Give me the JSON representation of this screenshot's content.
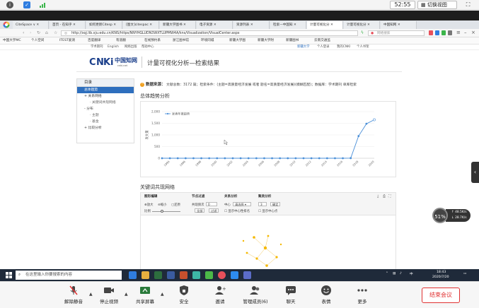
{
  "meeting_top": {
    "timer": "52:55",
    "switch_view": "切换视图"
  },
  "browser": {
    "tabs": [
      {
        "label": "CiteSpace ∨ ✕",
        "active": false
      },
      {
        "label": "首页 - 在知乎 ✕",
        "active": false
      },
      {
        "label": "如何更新Citesp ✕",
        "active": false
      },
      {
        "label": "[图文]citespac ✕",
        "active": false
      },
      {
        "label": "新疆大学图书 ✕",
        "active": false
      },
      {
        "label": "电子资源 ✕",
        "active": false
      },
      {
        "label": "资源列表 ✕",
        "active": false
      },
      {
        "label": "检索—中国知 ✕",
        "active": false
      },
      {
        "label": "计量可视化分 ✕",
        "active": true
      },
      {
        "label": "计量可视化分 ✕",
        "active": false
      },
      {
        "label": "中国知网 ✕",
        "active": false
      }
    ],
    "url": "http://xqj.lib.xju.edu.cn/KNS/https/NNYHGLUDN3WXTLUPMW4A/kns/Visualization/VisualCenter.aspx",
    "search_placeholder": "网络搜索",
    "bookmarks": [
      "中国大学MC",
      "个人空间",
      "ITEST爱测",
      "百度翻译",
      "有道翻",
      "在线预约系",
      "浙江图书馆",
      "环境同城",
      "新疆大学图",
      "新疆大学附",
      "新疆图书",
      "云南交通监"
    ],
    "site_nav": [
      "学术期刊",
      "English",
      "网络出版",
      "帮助中心"
    ],
    "site_nav_right": [
      "新疆大学",
      "个人登录",
      "我的CNKI",
      "个人书架"
    ]
  },
  "page": {
    "logo_text": "中国知网",
    "logo_sub": "cnki.net",
    "title": "计量可视化分析—检索结果",
    "left_nav": {
      "header": "目录",
      "items": [
        {
          "label": "总体趋势",
          "active": true,
          "level": 0
        },
        {
          "label": "+ 关系网络",
          "active": false,
          "level": 0
        },
        {
          "label": "· 关键词共现网络",
          "active": false,
          "level": 1
        },
        {
          "label": "- 分布",
          "active": false,
          "level": 0
        },
        {
          "label": "· 主题",
          "active": false,
          "level": 1
        },
        {
          "label": "· 基金",
          "active": false,
          "level": 1
        },
        {
          "label": "+ 比较分析",
          "active": false,
          "level": 0
        }
      ]
    },
    "crumb": {
      "source_label": "数据来源：",
      "text": "文献总数：3172 篇；检索条件：(主题=高质量经济发展 或者 题名=高质量经济发展)(模糊匹配)；数据库：学术期刊 单库检索"
    },
    "section1_title": "总体趋势分析",
    "section2_title": "关键词共现网络",
    "network_toolbar": {
      "g1_title": "图形编辑",
      "g1_items": [
        "放大",
        "缩小",
        "还原"
      ],
      "g1_zoom_label": "比例",
      "g2_title": "节点过滤",
      "g2_label": "共现频次",
      "g2_value": "0",
      "g2_btn1": "全部",
      "g2_btn2": "过滤",
      "g3_title": "关系分析",
      "g3_label": "中心",
      "g3_select": "请选择",
      "g3_chk": "显示中心性排名",
      "g4_title": "聚类分析",
      "g4_value": "3",
      "g4_btn": "确定",
      "g4_chk": "显示中心点"
    }
  },
  "chart_data": {
    "type": "line",
    "legend": [
      "发表年度趋势"
    ],
    "legend_position": "top-left",
    "ylabel": "发文量",
    "ylim": [
      0,
      2000
    ],
    "yticks": [
      0,
      500,
      1000,
      1500,
      2000
    ],
    "grid": true,
    "categories": [
      "1993",
      "1994",
      "1995",
      "1996",
      "1997",
      "1998",
      "1999",
      "2000",
      "2001",
      "2002",
      "2003",
      "2004",
      "2005",
      "2006",
      "2007",
      "2008",
      "2009",
      "2010",
      "2011",
      "2012",
      "2013",
      "2014",
      "2015",
      "2016",
      "2017",
      "2018",
      "2019",
      "2020"
    ],
    "xtick_labels": [
      "1994",
      "1996",
      "1998",
      "2000",
      "2002",
      "2004",
      "2006",
      "2008",
      "2010",
      "2012",
      "2014",
      "2016",
      "2018",
      "2020"
    ],
    "series": [
      {
        "name": "发表年度趋势",
        "color": "#4a8fd8",
        "values": [
          1,
          1,
          1,
          1,
          1,
          1,
          1,
          1,
          1,
          1,
          1,
          1,
          1,
          1,
          1,
          1,
          1,
          1,
          1,
          1,
          1,
          1,
          1,
          1,
          5,
          950,
          1480,
          1650
        ]
      }
    ]
  },
  "speed": {
    "percent": "51%",
    "up": "48.5K/s",
    "down": "28.7K/s"
  },
  "taskbar": {
    "search_placeholder": "在这里输入你要搜索的内容",
    "time": "18:43",
    "date": "2020/7/20",
    "tray_lang": "中"
  },
  "meeting_bar": {
    "items": [
      "解除静音",
      "停止视频",
      "共享屏幕",
      "安全",
      "邀请",
      "管理成员(6)",
      "聊天",
      "表情",
      "更多"
    ],
    "end": "结束会议"
  }
}
